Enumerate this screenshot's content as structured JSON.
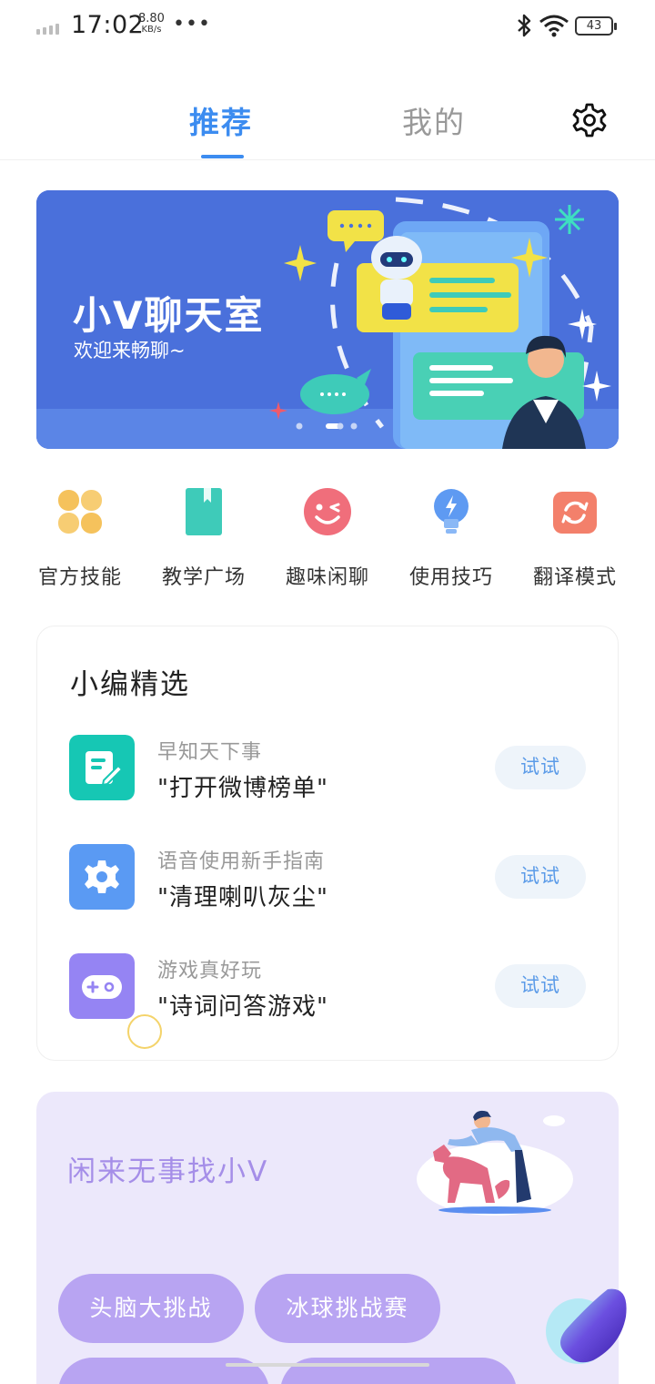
{
  "status_bar": {
    "time": "17:02",
    "speed_value": "8.80",
    "speed_unit": "KB/s",
    "more": "•••",
    "battery": "43"
  },
  "tabs": {
    "recommend": "推荐",
    "mine": "我的"
  },
  "banner": {
    "title": "小V聊天室",
    "subtitle": "欢迎来畅聊~"
  },
  "shortcuts": [
    {
      "label": "官方技能",
      "icon": "four-petal-icon",
      "color": "#f5c25c"
    },
    {
      "label": "教学广场",
      "icon": "book-icon",
      "color": "#3ecbb9"
    },
    {
      "label": "趣味闲聊",
      "icon": "wink-face-icon",
      "color": "#f06e7b"
    },
    {
      "label": "使用技巧",
      "icon": "lightbulb-icon",
      "color": "#5e9af2"
    },
    {
      "label": "翻译模式",
      "icon": "refresh-icon",
      "color": "#f3806b"
    }
  ],
  "picks": {
    "title": "小编精选",
    "items": [
      {
        "category": "早知天下事",
        "command": "\"打开微博榜单\"",
        "button": "试试",
        "icon": "note-edit-icon",
        "color": "#16c7b4"
      },
      {
        "category": "语音使用新手指南",
        "command": "\"清理喇叭灰尘\"",
        "button": "试试",
        "icon": "gear-icon",
        "color": "#5a9af3"
      },
      {
        "category": "游戏真好玩",
        "command": "\"诗词问答游戏\"",
        "button": "试试",
        "icon": "gamepad-icon",
        "color": "#9584f3"
      }
    ]
  },
  "idle": {
    "title": "闲来无事找小V",
    "chips": [
      "头脑大挑战",
      "冰球挑战赛"
    ]
  },
  "colors": {
    "accent": "#3c8cf0",
    "banner_bg": "#4a70db",
    "idle_bg": "#ece8fb",
    "chip": "#b8a4f2"
  }
}
